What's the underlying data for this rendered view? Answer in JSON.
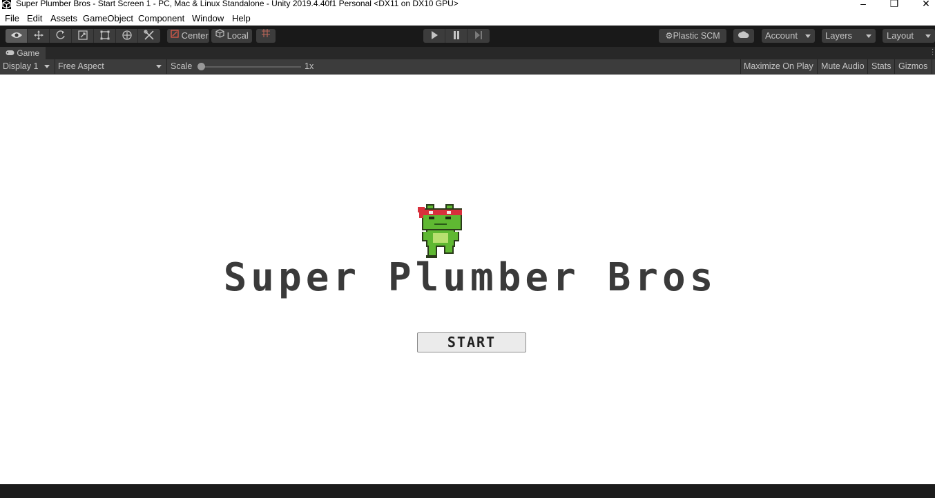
{
  "window": {
    "title": "Super Plumber Bros - Start Screen 1 - PC, Mac & Linux Standalone - Unity 2019.4.40f1 Personal <DX11 on DX10 GPU>",
    "minimize_glyph": "–",
    "maximize_glyph": "❐",
    "close_glyph": "✕"
  },
  "menu": {
    "items": [
      "File",
      "Edit",
      "Assets",
      "GameObject",
      "Component",
      "Window",
      "Help"
    ]
  },
  "toolbar": {
    "tools": [
      "view-tool",
      "move-tool",
      "rotate-tool",
      "scale-tool",
      "rect-tool",
      "transform-tool",
      "custom-tool"
    ],
    "pivot_mode": "Center",
    "pivot_rotation": "Local",
    "plastic_scm": "Plastic SCM",
    "account": "Account",
    "layers": "Layers",
    "layout": "Layout"
  },
  "tab": {
    "label": "Game"
  },
  "gamebar": {
    "display": "Display 1",
    "aspect": "Free Aspect",
    "scale_label": "Scale",
    "scale_value": "1x",
    "scale_fraction": 0.0,
    "maximize_on_play": "Maximize On Play",
    "mute_audio": "Mute Audio",
    "stats": "Stats",
    "gizmos": "Gizmos"
  },
  "game": {
    "title": "Super Plumber Bros",
    "start_button": "START"
  },
  "colors": {
    "toolbar_bg": "#191919",
    "panel_bg": "#3c3c3c",
    "text_light": "#c4c4c4",
    "game_bg": "#ffffff",
    "title_text": "#3a3a3a",
    "frog_green": "#5fb832",
    "headband_red": "#d8303c"
  }
}
